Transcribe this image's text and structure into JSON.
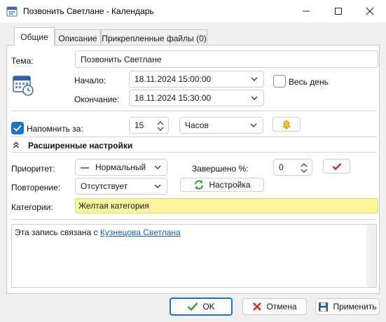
{
  "window": {
    "title": "Позвонить Светлане  - Календарь",
    "controls": {
      "minimize": "minimize",
      "maximize": "maximize",
      "close": "close"
    }
  },
  "tabs": [
    {
      "label": "Общие",
      "active": true
    },
    {
      "label": "Описание",
      "active": false
    },
    {
      "label": "Прикрепленные файлы (0)",
      "active": false
    }
  ],
  "general": {
    "subject_label": "Тема:",
    "subject_value": "Позвонить Светлане",
    "start_label": "Начало:",
    "start_value": "18.11.2024 15:00:00",
    "end_label": "Окончание:",
    "end_value": "18.11.2024 15:30:00",
    "all_day_label": "Весь день",
    "all_day_checked": false
  },
  "reminder": {
    "checked": true,
    "label": "Напомнить за:",
    "amount": "15",
    "unit": "Часов"
  },
  "advanced": {
    "header": "Расширенные настройки",
    "priority_label": "Приоритет:",
    "priority_value": "Нормальный",
    "priority_icon": "—",
    "completed_label": "Завершено %:",
    "completed_value": "0",
    "repeat_label": "Повторение:",
    "repeat_value": "Отсутствует",
    "setup_label": "Настройка",
    "categories_label": "Категории:",
    "categories_value": "Желтая категория",
    "category_color": "#fbf5a0"
  },
  "notes": {
    "prefix": "Эта запись связана с ",
    "link": "Кузнецова Светлана"
  },
  "footer": {
    "ok": "OK",
    "cancel": "Отмена",
    "apply": "Применить"
  },
  "colors": {
    "accent": "#1e73c7",
    "link": "#1a5fb4",
    "ok_green": "#3aa53a",
    "cancel_red": "#d93025",
    "check_red": "#d42424"
  }
}
